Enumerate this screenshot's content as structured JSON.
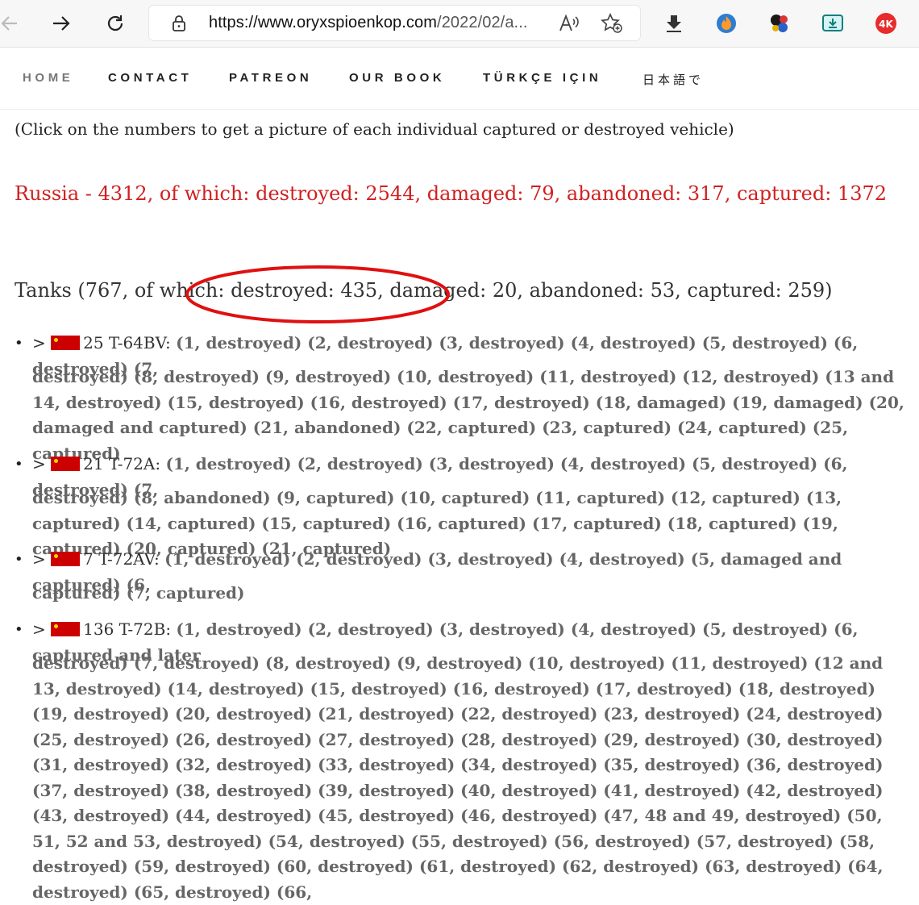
{
  "browser": {
    "url_host": "https://www.oryxspioenkop.com",
    "url_path": "/2022/02/a...",
    "read_aloud_label": "A͡»"
  },
  "nav": {
    "items": [
      "HOME",
      "CONTACT",
      "PATREON",
      "OUR BOOK",
      "TÜRKÇE IÇIN",
      "日本語で"
    ]
  },
  "content": {
    "intro": "(Click on the numbers to get a picture of each individual captured or destroyed vehicle)",
    "russia_summary": "Russia - 4312, of which: destroyed: 2544, damaged: 79, abandoned: 317, captured: 1372",
    "tanks_summary": "Tanks (767, of which: destroyed: 435, damaged: 20, abandoned: 53, captured: 259)",
    "highlight_color": "#e01010",
    "flag_color": "#cc0000",
    "models": [
      {
        "name": "25 T-64BV:",
        "line1": "(1, destroyed) (2, destroyed) (3, destroyed) (4, destroyed) (5, destroyed) (6, destroyed) (7,",
        "rest": "destroyed) (8, destroyed) (9, destroyed) (10, destroyed) (11, destroyed) (12, destroyed) (13 and 14, destroyed) (15, destroyed) (16, destroyed) (17, destroyed) (18, damaged) (19, damaged) (20, damaged and captured) (21, abandoned) (22, captured) (23, captured) (24, captured) (25, captured)"
      },
      {
        "name": "21 T-72A:",
        "line1": "(1, destroyed) (2, destroyed) (3, destroyed) (4, destroyed) (5, destroyed) (6, destroyed) (7,",
        "rest": "destroyed) (8, abandoned) (9, captured) (10, captured) (11, captured) (12, captured) (13, captured) (14, captured) (15, captured) (16, captured) (17, captured) (18, captured) (19, captured) (20, captured) (21, captured)"
      },
      {
        "name": "7 T-72AV:",
        "line1": "(1, destroyed) (2, destroyed) (3, destroyed) (4, destroyed) (5, damaged and captured) (6,",
        "rest": "captured) (7, captured)"
      },
      {
        "name": "136 T-72B:",
        "line1": "(1, destroyed) (2, destroyed) (3, destroyed) (4, destroyed) (5, destroyed) (6, captured and later",
        "rest": "destroyed) (7, destroyed) (8, destroyed) (9, destroyed) (10, destroyed) (11, destroyed) (12 and 13, destroyed) (14, destroyed) (15, destroyed) (16, destroyed) (17, destroyed) (18, destroyed) (19, destroyed) (20, destroyed) (21, destroyed) (22, destroyed) (23, destroyed) (24, destroyed) (25, destroyed) (26, destroyed) (27, destroyed) (28, destroyed) (29, destroyed) (30, destroyed) (31, destroyed) (32, destroyed) (33, destroyed) (34, destroyed) (35, destroyed) (36, destroyed) (37, destroyed) (38, destroyed) (39, destroyed) (40, destroyed) (41, destroyed) (42, destroyed) (43, destroyed) (44, destroyed) (45, destroyed) (46, destroyed) (47, 48 and 49, destroyed) (50, 51, 52 and 53, destroyed) (54, destroyed) (55, destroyed) (56, destroyed) (57, destroyed) (58, destroyed) (59, destroyed) (60, destroyed) (61, destroyed) (62, destroyed) (63, destroyed) (64, destroyed) (65, destroyed) (66,"
      }
    ]
  }
}
